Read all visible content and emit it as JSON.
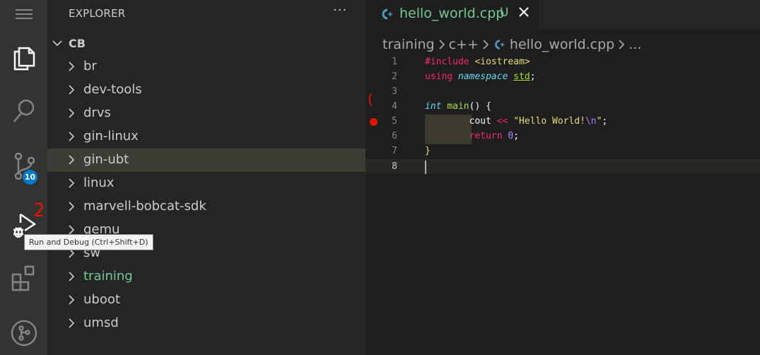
{
  "activity_bar": {
    "items": [
      {
        "name": "menu-icon"
      },
      {
        "name": "explorer-icon"
      },
      {
        "name": "search-icon"
      },
      {
        "name": "source-control-icon",
        "badge": "10"
      },
      {
        "name": "run-debug-icon"
      },
      {
        "name": "extensions-icon"
      },
      {
        "name": "remote-icon"
      }
    ]
  },
  "tooltip": "Run and Debug (Ctrl+Shift+D)",
  "explorer": {
    "title": "EXPLORER",
    "more": "···",
    "root": "CB",
    "items": [
      {
        "label": "br"
      },
      {
        "label": "dev-tools"
      },
      {
        "label": "drvs"
      },
      {
        "label": "gin-linux"
      },
      {
        "label": "gin-ubt",
        "state": "hover"
      },
      {
        "label": "linux"
      },
      {
        "label": "marvell-bobcat-sdk"
      },
      {
        "label": "qemu"
      },
      {
        "label": "sw"
      },
      {
        "label": "training",
        "color": "#73c991"
      },
      {
        "label": "uboot"
      },
      {
        "label": "umsd"
      }
    ]
  },
  "editor": {
    "tab": {
      "label": "hello_world.cpp",
      "status": "U"
    },
    "breadcrumb": [
      "training",
      "c++",
      "hello_world.cpp",
      "..."
    ],
    "lines": [
      "1",
      "2",
      "3",
      "4",
      "5",
      "6",
      "7",
      "8"
    ],
    "breakpoint_line": 5,
    "current_line": 8
  },
  "annotations": {
    "one": "(",
    "two": "2"
  },
  "colors": {
    "accent": "#007acc",
    "untracked": "#73c991",
    "breakpoint": "#e51400"
  }
}
